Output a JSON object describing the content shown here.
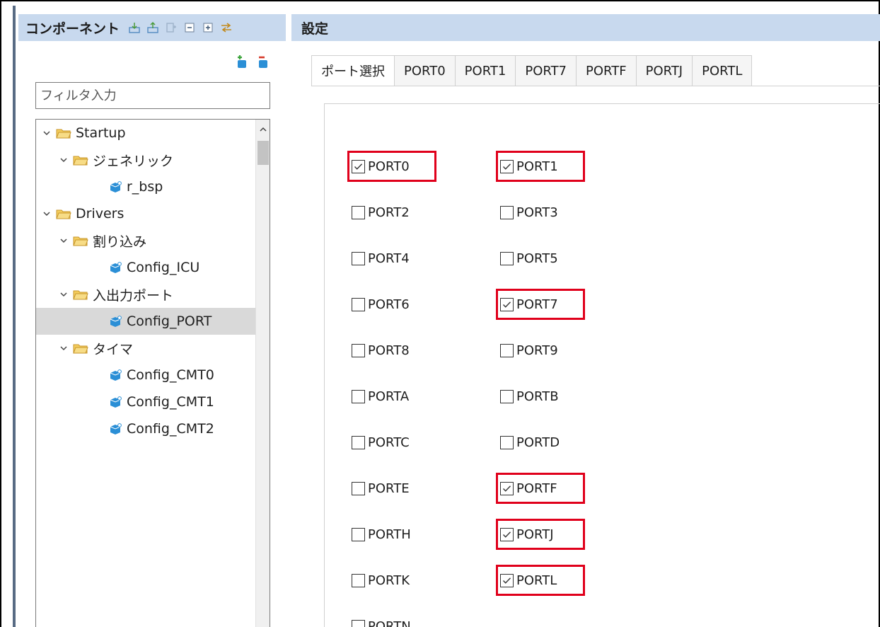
{
  "left_panel": {
    "title": "コンポーネント",
    "header_icons": [
      "import-icon",
      "export-icon",
      "generate-icon",
      "collapse-all-icon",
      "expand-all-icon",
      "link-icon"
    ],
    "add_icons": [
      "add-component-icon",
      "remove-component-icon"
    ],
    "filter_placeholder": "フィルタ入力",
    "tree": [
      {
        "label": "Startup",
        "type": "folder",
        "level": 0,
        "expanded": true
      },
      {
        "label": "ジェネリック",
        "type": "folder",
        "level": 1,
        "expanded": true
      },
      {
        "label": "r_bsp",
        "type": "component",
        "level": 2
      },
      {
        "label": "Drivers",
        "type": "folder",
        "level": 0,
        "expanded": true
      },
      {
        "label": "割り込み",
        "type": "folder",
        "level": 1,
        "expanded": true
      },
      {
        "label": "Config_ICU",
        "type": "component",
        "level": 2
      },
      {
        "label": "入出力ポート",
        "type": "folder",
        "level": 1,
        "expanded": true
      },
      {
        "label": "Config_PORT",
        "type": "component",
        "level": 2,
        "selected": true
      },
      {
        "label": "タイマ",
        "type": "folder",
        "level": 1,
        "expanded": true
      },
      {
        "label": "Config_CMT0",
        "type": "component",
        "level": 2
      },
      {
        "label": "Config_CMT1",
        "type": "component",
        "level": 2
      },
      {
        "label": "Config_CMT2",
        "type": "component",
        "level": 2
      }
    ]
  },
  "right_panel": {
    "title": "設定",
    "tabs": [
      {
        "label": "ポート選択",
        "active": true
      },
      {
        "label": "PORT0"
      },
      {
        "label": "PORT1"
      },
      {
        "label": "PORT7"
      },
      {
        "label": "PORTF"
      },
      {
        "label": "PORTJ"
      },
      {
        "label": "PORTL"
      }
    ],
    "ports": [
      {
        "label": "PORT0",
        "checked": true
      },
      {
        "label": "PORT1",
        "checked": true
      },
      {
        "label": "PORT2",
        "checked": false
      },
      {
        "label": "PORT3",
        "checked": false
      },
      {
        "label": "PORT4",
        "checked": false
      },
      {
        "label": "PORT5",
        "checked": false
      },
      {
        "label": "PORT6",
        "checked": false
      },
      {
        "label": "PORT7",
        "checked": true
      },
      {
        "label": "PORT8",
        "checked": false
      },
      {
        "label": "PORT9",
        "checked": false
      },
      {
        "label": "PORTA",
        "checked": false
      },
      {
        "label": "PORTB",
        "checked": false
      },
      {
        "label": "PORTC",
        "checked": false
      },
      {
        "label": "PORTD",
        "checked": false
      },
      {
        "label": "PORTE",
        "checked": false
      },
      {
        "label": "PORTF",
        "checked": true
      },
      {
        "label": "PORTH",
        "checked": false
      },
      {
        "label": "PORTJ",
        "checked": true
      },
      {
        "label": "PORTK",
        "checked": false
      },
      {
        "label": "PORTL",
        "checked": true
      },
      {
        "label": "PORTN",
        "checked": false
      }
    ]
  },
  "colors": {
    "header_bg": "#c8d9ee",
    "highlight": "#e0001b",
    "selected_row": "#d9d9d9",
    "folder": "#e9b949",
    "component": "#2b8fd6"
  }
}
